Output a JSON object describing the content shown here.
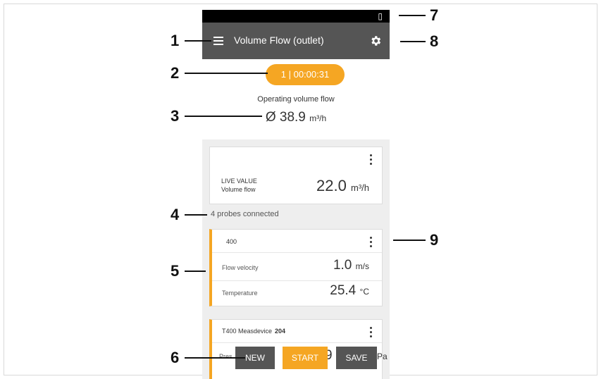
{
  "status_bar": {
    "vibrate_icon": "vibrate-icon"
  },
  "app_bar": {
    "title": "Volume Flow (outlet)",
    "menu_icon": "hamburger-menu-icon",
    "settings_icon": "gear-icon"
  },
  "timer": {
    "label": "1 | 00:00:31"
  },
  "operating": {
    "label": "Operating volume flow",
    "value": "Ø 38.9",
    "unit": "m³/h"
  },
  "live_card": {
    "label_line1": "LIVE VALUE",
    "label_line2": "Volume flow",
    "value": "22.0",
    "unit": "m³/h"
  },
  "probes_connected": "4 probes connected",
  "probe_card": {
    "title": "400",
    "rows": [
      {
        "label": "Flow velocity",
        "value": "1.0",
        "unit": "m/s"
      },
      {
        "label": "Temperature",
        "value": "25.4",
        "unit": "°C"
      }
    ]
  },
  "probe2_card": {
    "device": "T400 Measdevice",
    "number": "204",
    "partial_label": "Pres",
    "partial_value": "9",
    "partial_unit": "Pa"
  },
  "buttons": {
    "new": "NEW",
    "start": "START",
    "save": "SAVE"
  },
  "callouts": [
    "1",
    "2",
    "3",
    "4",
    "5",
    "6",
    "7",
    "8",
    "9"
  ],
  "colors": {
    "accent": "#f5a623",
    "appbar": "#555555",
    "list_bg": "#eeeeee"
  }
}
